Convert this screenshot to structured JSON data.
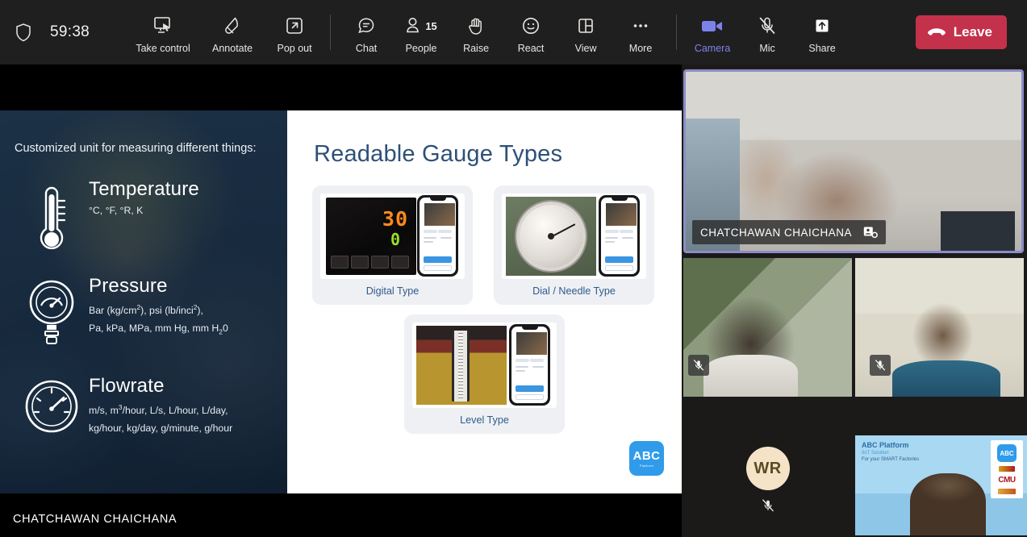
{
  "toolbar": {
    "shield_icon": "shield-icon",
    "timer": "59:38",
    "buttons": [
      {
        "label": "Take control",
        "icon": "screen-cursor-icon"
      },
      {
        "label": "Annotate",
        "icon": "pen-icon"
      },
      {
        "label": "Pop out",
        "icon": "pop-out-icon"
      },
      {
        "label": "Chat",
        "icon": "chat-bubble-icon"
      },
      {
        "label": "People",
        "icon": "person-icon",
        "badge": "15"
      },
      {
        "label": "Raise",
        "icon": "raised-hand-icon"
      },
      {
        "label": "React",
        "icon": "smiley-icon"
      },
      {
        "label": "View",
        "icon": "layout-grid-icon"
      },
      {
        "label": "More",
        "icon": "ellipsis-icon"
      },
      {
        "label": "Camera",
        "icon": "camera-on-icon"
      },
      {
        "label": "Mic",
        "icon": "mic-muted-icon"
      },
      {
        "label": "Share",
        "icon": "share-up-arrow-icon"
      }
    ],
    "leave_label": "Leave",
    "leave_icon": "hangup-phone-icon",
    "accent_purple": "#7b83eb",
    "leave_red": "#c4314b"
  },
  "slide": {
    "left_panel": {
      "intro": "Customized unit for measuring different things:",
      "items": [
        {
          "icon": "thermometer-icon",
          "title": "Temperature",
          "units": "°C, °F, °R, K"
        },
        {
          "icon": "pressure-gauge-icon",
          "title": "Pressure",
          "units_line1": "Bar (kg/cm2), psi (lb/inci2),",
          "units_line2": "Pa, kPa, MPa, mm Hg, mm H2O"
        },
        {
          "icon": "flowmeter-icon",
          "title": "Flowrate",
          "units_line1": "m/s, m3/hour, L/s, L/hour, L/day,",
          "units_line2": "kg/hour, kg/day, g/minute, g/hour"
        }
      ]
    },
    "right_panel": {
      "title": "Readable Gauge Types",
      "title_color": "#2e5077",
      "cards": [
        {
          "label": "Digital Type",
          "media": "digital-controller-photo",
          "digital_value_top": "30",
          "digital_value_bottom": "0"
        },
        {
          "label": "Dial / Needle Type",
          "media": "dial-gauge-photo"
        },
        {
          "label": "Level Type",
          "media": "level-gauge-photo"
        }
      ],
      "logo": {
        "name": "abc-platform-logo",
        "text": "ABC",
        "sub": "Platform",
        "color": "#2f9bea"
      }
    },
    "presenter_name": "CHATCHAWAN CHAICHANA"
  },
  "rail": {
    "tiles": [
      {
        "name": "CHATCHAWAN CHAICHANA",
        "active_speaker": true,
        "border_color": "#8b8cc7",
        "pin_icon": "pinned-participant-icon"
      },
      {
        "name": "",
        "muted": true,
        "mic_icon": "mic-muted-icon"
      },
      {
        "name": "",
        "muted": true,
        "mic_icon": "mic-muted-icon"
      },
      {
        "name": "",
        "initials": "WR",
        "muted": true,
        "mic_icon": "mic-muted-icon"
      },
      {
        "name": "",
        "overflow": "···"
      },
      {
        "name": "",
        "screen_title": "ABC Platform",
        "screen_sub1": "IIoT Solution",
        "screen_sub2": "For your SMART Factories",
        "screen_logo": "ABC",
        "screen_logo2": "CMU"
      }
    ]
  }
}
